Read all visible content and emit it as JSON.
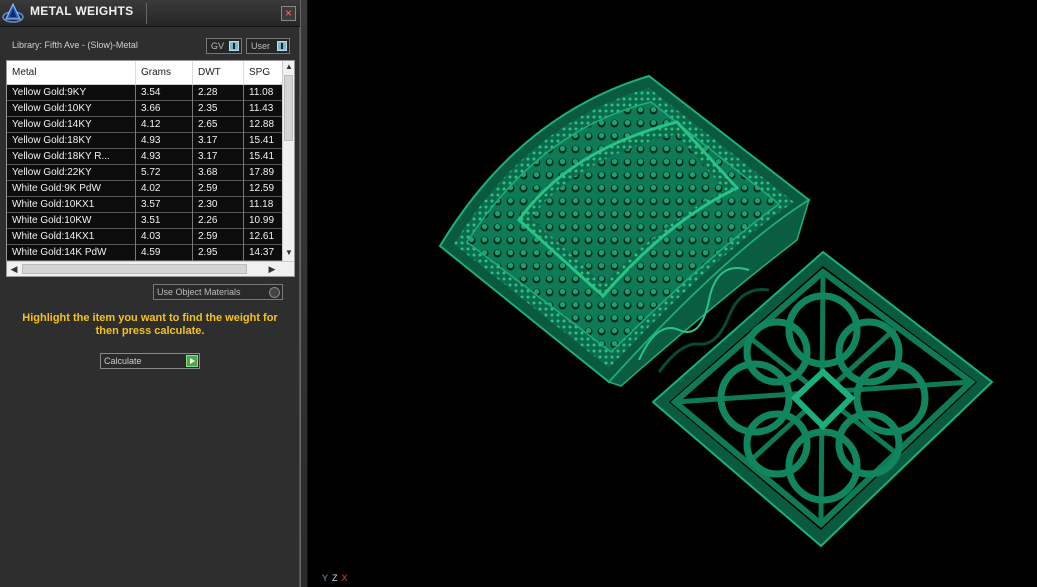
{
  "panel": {
    "title": "METAL WEIGHTS",
    "close_label": "×",
    "library_label": "Library: Fifth Ave - (Slow)-Metal",
    "toggle_gv": "GV",
    "toggle_user": "User",
    "columns": [
      "Metal",
      "Grams",
      "DWT",
      "SPG"
    ],
    "rows": [
      [
        "Yellow Gold:9KY",
        "3.54",
        "2.28",
        "11.08"
      ],
      [
        "Yellow Gold:10KY",
        "3.66",
        "2.35",
        "11.43"
      ],
      [
        "Yellow Gold:14KY",
        "4.12",
        "2.65",
        "12.88"
      ],
      [
        "Yellow Gold:18KY",
        "4.93",
        "3.17",
        "15.41"
      ],
      [
        "Yellow Gold:18KY R...",
        "4.93",
        "3.17",
        "15.41"
      ],
      [
        "Yellow Gold:22KY",
        "5.72",
        "3.68",
        "17.89"
      ],
      [
        "White Gold:9K PdW",
        "4.02",
        "2.59",
        "12.59"
      ],
      [
        "White Gold:10KX1",
        "3.57",
        "2.30",
        "11.18"
      ],
      [
        "White Gold:10KW",
        "3.51",
        "2.26",
        "10.99"
      ],
      [
        "White Gold:14KX1",
        "4.03",
        "2.59",
        "12.61"
      ],
      [
        "White Gold:14K PdW",
        "4.59",
        "2.95",
        "14.37"
      ]
    ],
    "use_object_materials": "Use Object Materials",
    "hint": "Highlight the item you want to find the weight for then press calculate.",
    "calculate_label": "Calculate"
  },
  "viewport": {
    "axis_y": "Y",
    "axis_z": "Z",
    "axis_x": "X",
    "colors": {
      "model": "#0f7a57",
      "axis_y": "#5fa8d8",
      "axis_z": "#dddddd",
      "axis_x": "#d84a4a"
    }
  }
}
